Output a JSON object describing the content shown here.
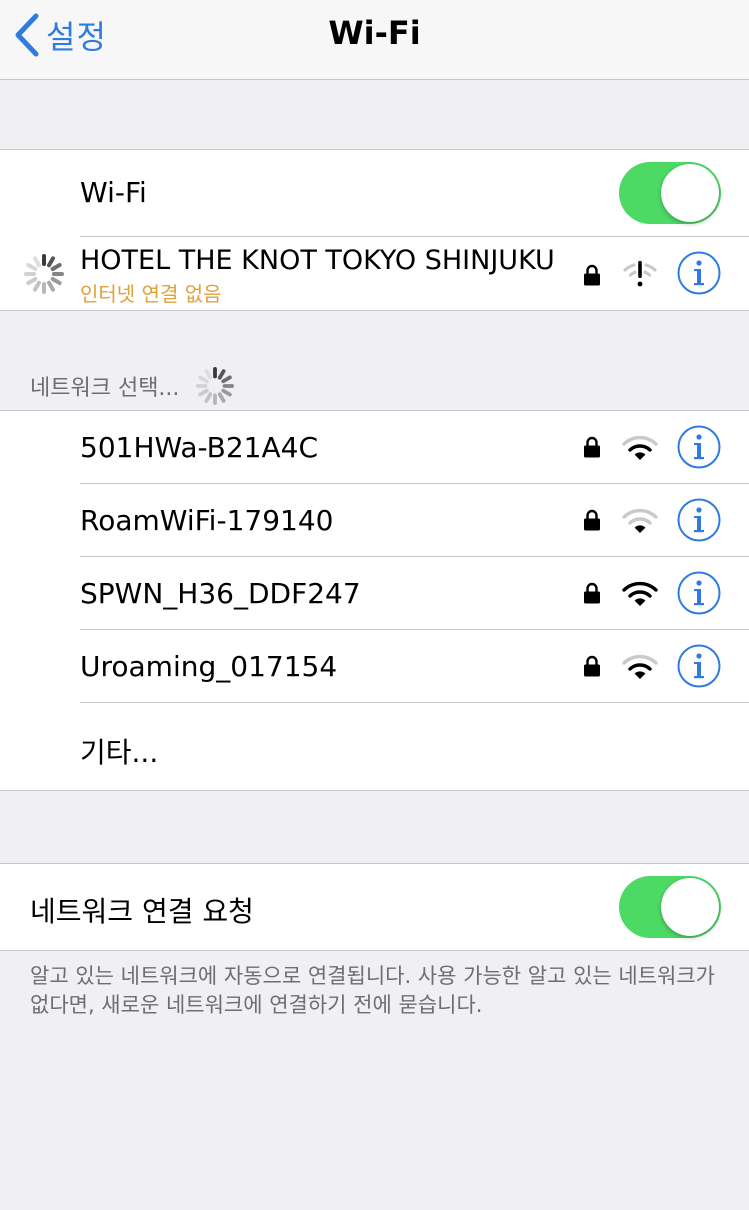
{
  "navbar": {
    "back_label": "설정",
    "title": "Wi-Fi"
  },
  "wifi_toggle": {
    "label": "Wi-Fi",
    "on": true
  },
  "current_network": {
    "name": "HOTEL THE KNOT TOKYO SHINJUKU",
    "status": "인터넷 연결 없음",
    "status_color": "#e0a03a",
    "secured": true,
    "signal_icon": "wifi-no-internet-icon"
  },
  "networks_section": {
    "header": "네트워크 선택..."
  },
  "networks": [
    {
      "name": "501HWa-B21A4C",
      "secured": true,
      "signal_bars": 2
    },
    {
      "name": "RoamWiFi-179140",
      "secured": true,
      "signal_bars": 1
    },
    {
      "name": "SPWN_H36_DDF247",
      "secured": true,
      "signal_bars": 3
    },
    {
      "name": "Uroaming_017154",
      "secured": true,
      "signal_bars": 2
    }
  ],
  "other_label": "기타...",
  "ask_to_join": {
    "label": "네트워크 연결 요청",
    "on": true
  },
  "footer": "알고 있는 네트워크에 자동으로 연결됩니다. 사용 가능한 알고 있는 네트워크가 없다면, 새로운 네트워크에 연결하기 전에 묻습니다.",
  "colors": {
    "accent": "#2f7be0",
    "toggle_on": "#4cd964",
    "background": "#efeff4"
  }
}
